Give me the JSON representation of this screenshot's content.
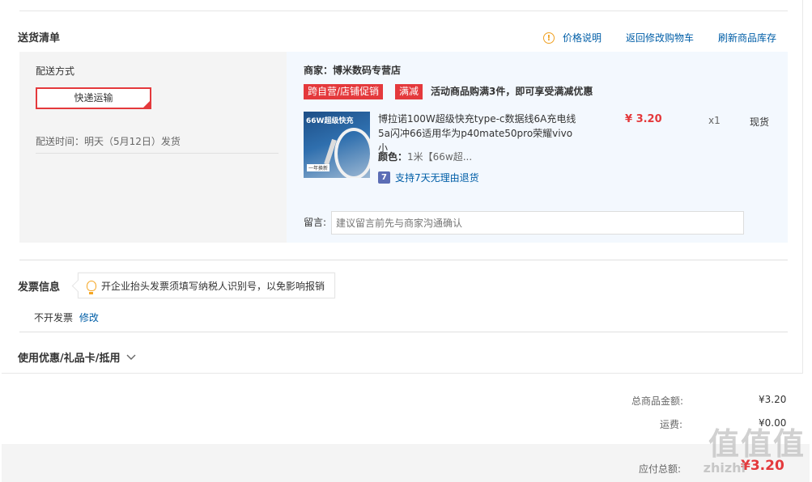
{
  "shipping": {
    "title": "送货清单",
    "links": {
      "price_info": "价格说明",
      "back_to_cart": "返回修改购物车",
      "refresh_stock": "刷新商品库存"
    },
    "method_label": "配送方式",
    "method_value": "快递运输",
    "time_text": "配送时间：明天（5月12日）发货",
    "merchant": "商家：博米数码专营店",
    "tags": [
      "跨自营/店铺促销",
      "满减"
    ],
    "promo_text": "活动商品购满3件，即可享受满减优惠",
    "product": {
      "thumb_text": "66W超级快充",
      "thumb_badge": "一年换新",
      "name": "博拉诺100W超级快充type-c数据线6A充电线5a闪冲66适用华为p40mate50pro荣耀vivo小",
      "color_label": "颜色：",
      "color_value": "1米【66w超...",
      "price": "¥ 3.20",
      "qty": "x1",
      "stock": "现货",
      "return_policy": "支持7天无理由退货",
      "return_icon": "7"
    },
    "remark_label": "留言:",
    "remark_placeholder": "建议留言前先与商家沟通确认"
  },
  "invoice": {
    "title": "发票信息",
    "tip": "开企业抬头发票须填写纳税人识别号，以免影响报销",
    "status": "不开发票",
    "edit": "修改"
  },
  "coupon": {
    "title": "使用优惠/礼品卡/抵用"
  },
  "summary": {
    "goods_total_label": "总商品金额:",
    "goods_total": "¥3.20",
    "shipping_fee_label": "运费:",
    "shipping_fee": "¥0.00",
    "payable_label": "应付总额:",
    "payable": "¥3.20"
  },
  "watermark": {
    "logo": "值",
    "site": "zhizhi"
  },
  "colors": {
    "accent_red": "#e4393c",
    "link_blue": "#005ea7"
  }
}
